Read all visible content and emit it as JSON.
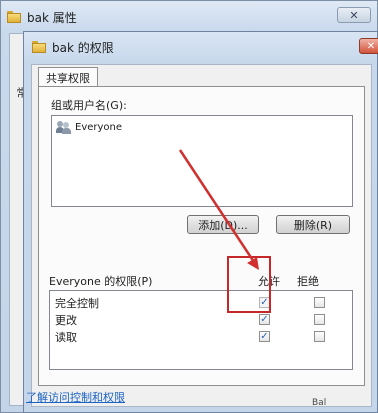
{
  "back_window": {
    "title": "bak 属性",
    "close_symbol": "✕",
    "edge_text": "常"
  },
  "dialog": {
    "title": "bak 的权限",
    "close_symbol": "✕",
    "tab_label": "共享权限",
    "group_label": "组或用户名(G):",
    "users": [
      {
        "name": "Everyone",
        "icon": "users-icon"
      }
    ],
    "add_button": "添加(D)...",
    "remove_button": "删除(R)",
    "permissions_title": "Everyone 的权限(P)",
    "allow_label": "允许",
    "deny_label": "拒绝",
    "permissions": [
      {
        "name": "完全控制",
        "allow": true,
        "allow_disabled": true,
        "deny": false
      },
      {
        "name": "更改",
        "allow": true,
        "allow_disabled": false,
        "deny": false
      },
      {
        "name": "读取",
        "allow": true,
        "allow_disabled": false,
        "deny": false
      }
    ],
    "help_link": "了解访问控制和权限"
  },
  "annotation": {
    "arrow_color": "#d22f2f",
    "box_color": "#c6282a"
  },
  "watermark": "Bal"
}
